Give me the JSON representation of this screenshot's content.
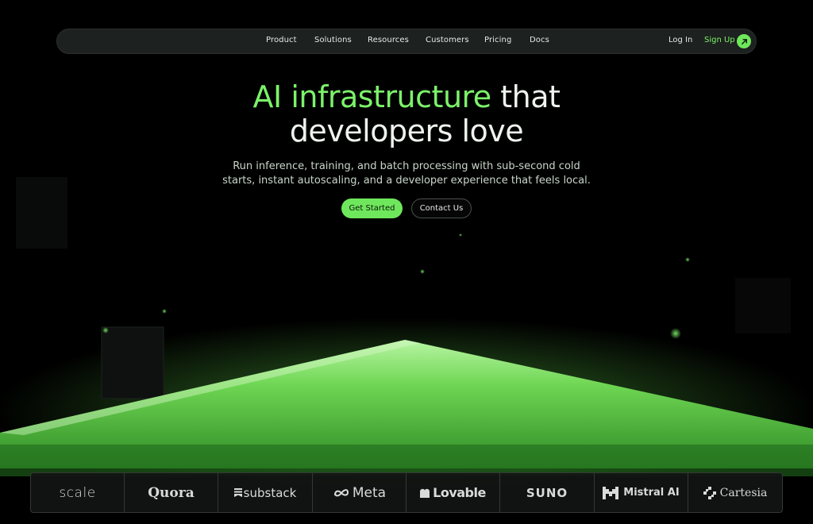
{
  "nav": {
    "links": [
      "Product",
      "Solutions",
      "Resources",
      "Customers",
      "Pricing",
      "Docs"
    ],
    "login": "Log In",
    "signup": "Sign Up"
  },
  "hero": {
    "headline_accent": "AI infrastructure",
    "headline_rest": " that",
    "headline_line2": "developers love",
    "subtitle_line1": "Run inference, training, and batch processing with sub-second cold",
    "subtitle_line2": "starts, instant autoscaling, and a developer experience that feels local.",
    "primary_cta": "Get Started",
    "secondary_cta": "Contact Us"
  },
  "logos": [
    "scale",
    "Quora",
    "substack",
    "Meta",
    "Lovable",
    "SUNO",
    "Mistral AI",
    "Cartesia"
  ],
  "colors": {
    "accent": "#7cf26a",
    "button": "#6fe75c",
    "background": "#000000"
  }
}
